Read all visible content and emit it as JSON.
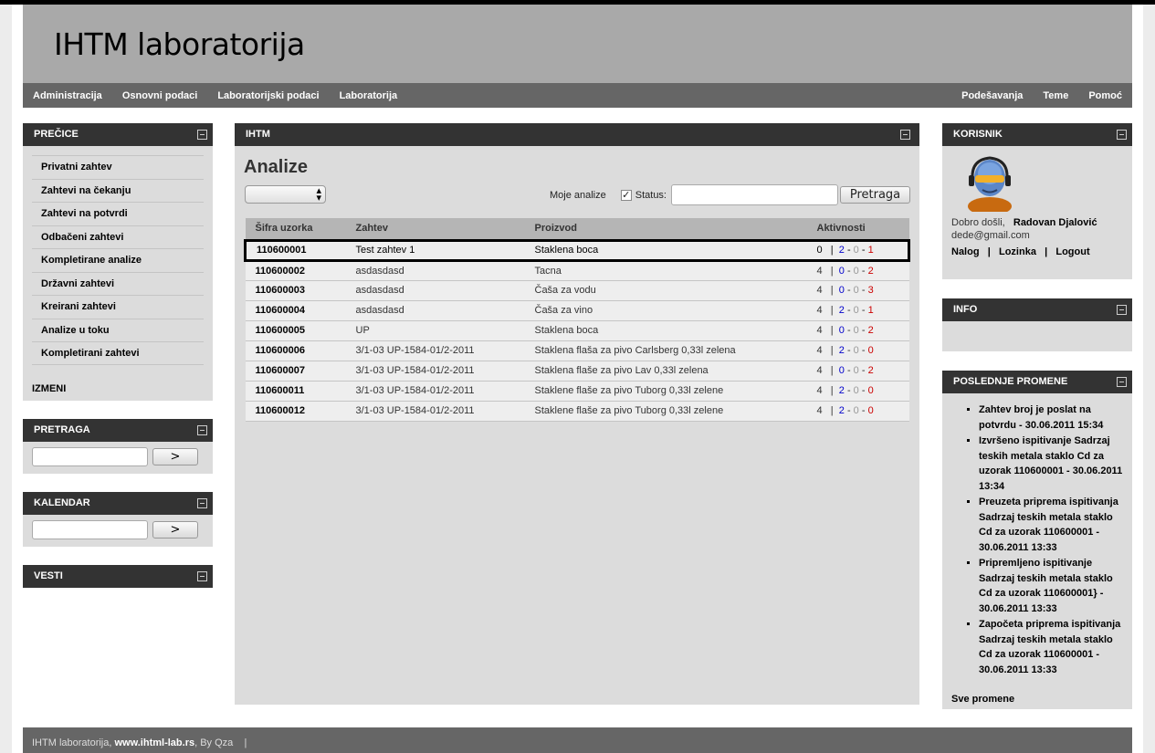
{
  "site": {
    "title": "IHTM laboratorija"
  },
  "nav": {
    "left": [
      "Administracija",
      "Osnovni podaci",
      "Laboratorijski podaci",
      "Laboratorija"
    ],
    "right": [
      "Podešavanja",
      "Teme",
      "Pomoć"
    ]
  },
  "precice": {
    "title": "PREČICE",
    "items": [
      "Privatni zahtev",
      "Zahtevi na čekanju",
      "Zahtevi na potvrdi",
      "Odbačeni zahtevi",
      "Kompletirane analize",
      "Državni zahtevi",
      "Kreirani zahtevi",
      "Analize u toku",
      "Kompletirani zahtevi"
    ],
    "edit_label": "IZMENI"
  },
  "pretraga": {
    "title": "PRETRAGA",
    "button": ">"
  },
  "kalendar": {
    "title": "KALENDAR",
    "button": ">"
  },
  "vesti": {
    "title": "VESTI"
  },
  "main": {
    "panel_title": "IHTM",
    "heading": "Analize",
    "moje_analize": "Moje analize",
    "status_label": "Status:",
    "search_button": "Pretraga",
    "columns": [
      "Šifra uzorka",
      "Zahtev",
      "Proizvod",
      "Aktivnosti"
    ],
    "rows": [
      {
        "code": "110600001",
        "zahtev": "Test zahtev 1",
        "proizvod": "Staklena boca",
        "n": "0",
        "a": "2",
        "b": "0",
        "c": "1"
      },
      {
        "code": "110600002",
        "zahtev": "asdasdasd",
        "proizvod": "Tacna",
        "n": "4",
        "a": "0",
        "b": "0",
        "c": "2"
      },
      {
        "code": "110600003",
        "zahtev": "asdasdasd",
        "proizvod": "Čaša za vodu",
        "n": "4",
        "a": "0",
        "b": "0",
        "c": "3"
      },
      {
        "code": "110600004",
        "zahtev": "asdasdasd",
        "proizvod": "Čaša za vino",
        "n": "4",
        "a": "2",
        "b": "0",
        "c": "1"
      },
      {
        "code": "110600005",
        "zahtev": "UP",
        "proizvod": "Staklena boca",
        "n": "4",
        "a": "0",
        "b": "0",
        "c": "2"
      },
      {
        "code": "110600006",
        "zahtev": "3/1-03 UP-1584-01/2-2011",
        "proizvod": "Staklena flaša za pivo Carlsberg 0,33l zelena",
        "n": "4",
        "a": "2",
        "b": "0",
        "c": "0"
      },
      {
        "code": "110600007",
        "zahtev": "3/1-03 UP-1584-01/2-2011",
        "proizvod": "Staklena flaše za pivo Lav 0,33l zelena",
        "n": "4",
        "a": "0",
        "b": "0",
        "c": "2"
      },
      {
        "code": "110600011",
        "zahtev": "3/1-03 UP-1584-01/2-2011",
        "proizvod": "Staklene flaše za pivo Tuborg 0,33l zelene",
        "n": "4",
        "a": "2",
        "b": "0",
        "c": "0"
      },
      {
        "code": "110600012",
        "zahtev": "3/1-03 UP-1584-01/2-2011",
        "proizvod": "Staklene flaše za pivo Tuborg 0,33l zelene",
        "n": "4",
        "a": "2",
        "b": "0",
        "c": "0"
      }
    ]
  },
  "korisnik": {
    "title": "KORISNIK",
    "greeting": "Dobro došli,",
    "name": "Radovan Djalović",
    "email": "dede@gmail.com",
    "links": [
      "Nalog",
      "Lozinka",
      "Logout"
    ]
  },
  "info": {
    "title": "INFO"
  },
  "promene": {
    "title": "POSLEDNJE PROMENE",
    "items": [
      "Zahtev broj je poslat na potvrdu - 30.06.2011 15:34",
      "Izvršeno ispitivanje Sadrzaj teskih metala staklo Cd za uzorak 110600001 - 30.06.2011 13:34",
      "Preuzeta priprema ispitivanja Sadrzaj teskih metala staklo Cd za uzorak 110600001 - 30.06.2011 13:33",
      "Pripremljeno ispitivanje Sadrzaj teskih metala staklo Cd za uzorak 110600001} - 30.06.2011 13:33",
      "Započeta priprema ispitivanja Sadrzaj teskih metala staklo Cd za uzorak 110600001 - 30.06.2011 13:33"
    ],
    "all_link": "Sve promene"
  },
  "footer": {
    "prefix": "IHTM laboratorija,",
    "site": "www.ihtml-lab.rs",
    "suffix": ", By Qza",
    "sep": "|"
  }
}
